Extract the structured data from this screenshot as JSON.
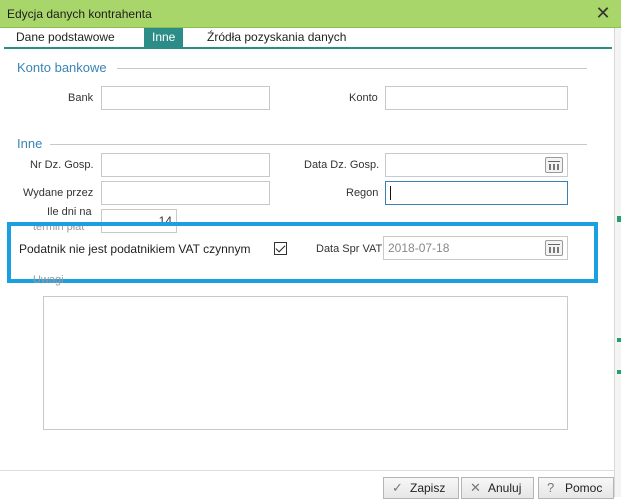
{
  "window": {
    "title": "Edycja danych kontrahenta",
    "close_glyph": "✕"
  },
  "tabs": [
    {
      "label": "Dane podstawowe",
      "active": false
    },
    {
      "label": "Inne",
      "active": true
    },
    {
      "label": "Źródła pozyskania danych",
      "active": false
    }
  ],
  "konto_section": {
    "title": "Konto bankowe",
    "bank_label": "Bank",
    "bank_value": "",
    "konto_label": "Konto",
    "konto_value": ""
  },
  "inne_section": {
    "title": "Inne",
    "nr_dz_label": "Nr Dz. Gosp.",
    "nr_dz_value": "",
    "data_dz_label": "Data Dz. Gosp.",
    "data_dz_value": "",
    "wydane_label": "Wydane przez",
    "wydane_value": "",
    "regon_label": "Regon",
    "regon_value": "",
    "ile_dni_label_1": "Ile dni na",
    "ile_dni_label_2": "termin płat",
    "ile_dni_value": "14"
  },
  "vat": {
    "checkbox_label": "Podatnik nie jest podatnikiem VAT czynnym",
    "checked": true,
    "data_spr_label": "Data Spr VAT",
    "data_spr_value": "2018-07-18"
  },
  "uwagi": {
    "label": "Uwagi",
    "value": ""
  },
  "footer": {
    "save_label": "Zapisz",
    "save_icon": "check-icon",
    "cancel_label": "Anuluj",
    "cancel_icon": "x-icon",
    "help_label": "Pomoc",
    "help_icon": "question-icon"
  },
  "colors": {
    "titlebar": "#a9d66a",
    "tab_active": "#2c8c87",
    "section_title": "#3a84b6",
    "highlight": "#1aa0e0"
  }
}
